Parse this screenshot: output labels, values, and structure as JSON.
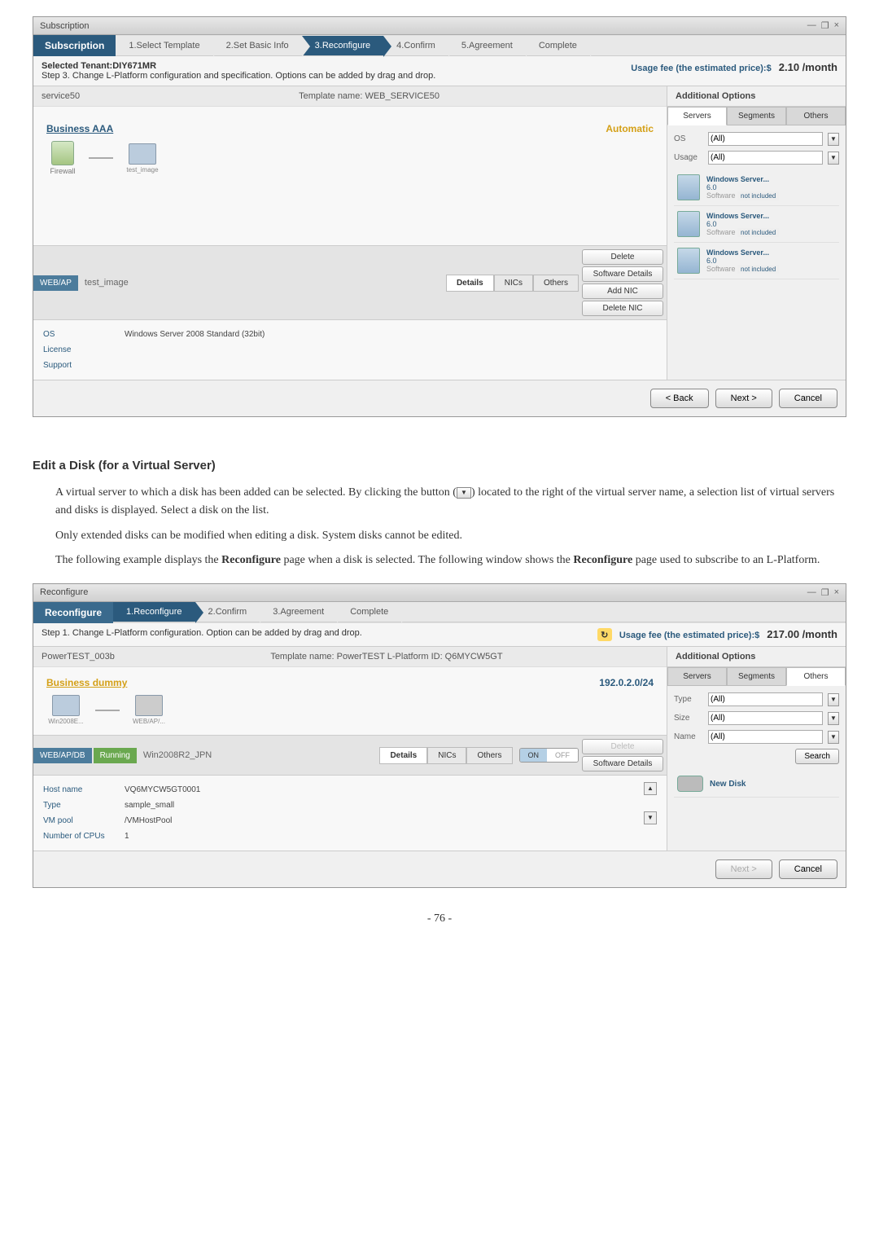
{
  "page_number": "- 76 -",
  "doc": {
    "heading": "Edit a Disk (for a Virtual Server)",
    "p1a": "A virtual server to which a disk has been added can be selected. By clicking the button (",
    "p1b": ") located to the right of the virtual server name, a selection list of virtual servers and disks is displayed. Select a disk on the list.",
    "p2": "Only extended disks can be modified when editing a disk. System disks cannot be edited.",
    "p3a": "The following example displays the ",
    "p3b": "Reconfigure",
    "p3c": " page when a disk is selected. The following window shows the ",
    "p3d": "Reconfigure",
    "p3e": " page used to subscribe to an L-Platform.",
    "dd_glyph": "▼"
  },
  "shot1": {
    "title": "Subscription",
    "tab": "Subscription",
    "steps": [
      "1.Select Template",
      "2.Set Basic Info",
      "3.Reconfigure",
      "4.Confirm",
      "5.Agreement",
      "Complete"
    ],
    "tenant_label": "Selected Tenant:",
    "tenant": "DIY671MR",
    "step_desc": "Step 3. Change L-Platform configuration and specification. Options can be added by drag and drop.",
    "usage_label": "Usage fee (the estimated price):$",
    "usage_price": "2.10 /month",
    "service_name": "service50",
    "template_label": "Template name: WEB_SERVICE50",
    "business_label": "Business AAA",
    "auto_label": "Automatic",
    "fw_label": "Firewall",
    "node_label": "test_image",
    "sidebar": {
      "title": "Additional Options",
      "tabs": [
        "Servers",
        "Segments",
        "Others"
      ],
      "os_label": "OS",
      "os_val": "(All)",
      "usage_label": "Usage",
      "usage_val": "(All)",
      "srv_name": "Windows Server...",
      "srv_ver": "6.0",
      "srv_sw": "Software",
      "srv_incl": "not included"
    },
    "detail": {
      "badge": "WEB/AP",
      "title": "test_image",
      "tabs": [
        "Details",
        "NICs",
        "Others"
      ],
      "actions": [
        "Delete",
        "Software Details",
        "Add NIC",
        "Delete NIC"
      ],
      "rows": {
        "os_label": "OS",
        "os_val": "Windows Server 2008 Standard (32bit)",
        "lic_label": "License",
        "sup_label": "Support"
      }
    },
    "footer": {
      "back": "< Back",
      "next": "Next >",
      "cancel": "Cancel"
    }
  },
  "shot2": {
    "title": "Reconfigure",
    "tab": "Reconfigure",
    "steps": [
      "1.Reconfigure",
      "2.Confirm",
      "3.Agreement",
      "Complete"
    ],
    "step_desc": "Step 1. Change L-Platform configuration. Option can be added by drag and drop.",
    "usage_label": "Usage fee (the estimated price):$",
    "usage_price": "217.00 /month",
    "service_name": "PowerTEST_003b",
    "template_label": "Template name: PowerTEST  L-Platform ID: Q6MYCW5GT",
    "business_label": "Business dummy",
    "segment": "192.0.2.0/24",
    "node1": "Win2008E...",
    "node2": "WEB/AP/...",
    "sidebar": {
      "title": "Additional Options",
      "tabs": [
        "Servers",
        "Segments",
        "Others"
      ],
      "type_label": "Type",
      "type_val": "(All)",
      "size_label": "Size",
      "size_val": "(All)",
      "name_label": "Name",
      "name_val": "(All)",
      "search": "Search",
      "new_disk": "New Disk"
    },
    "detail": {
      "badge": "WEB/AP/DB",
      "badge2": "Running",
      "title": "Win2008R2_JPN",
      "tabs": [
        "Details",
        "NICs",
        "Others"
      ],
      "toggle_on": "ON",
      "toggle_off": "OFF",
      "actions": [
        "Delete",
        "Software Details"
      ],
      "rows": {
        "host_label": "Host name",
        "host_val": "VQ6MYCW5GT0001",
        "type_label": "Type",
        "type_val": "sample_small",
        "vm_label": "VM pool",
        "vm_val": "/VMHostPool",
        "cpu_label": "Number of CPUs",
        "cpu_val": "1"
      }
    },
    "footer": {
      "next": "Next >",
      "cancel": "Cancel"
    }
  }
}
